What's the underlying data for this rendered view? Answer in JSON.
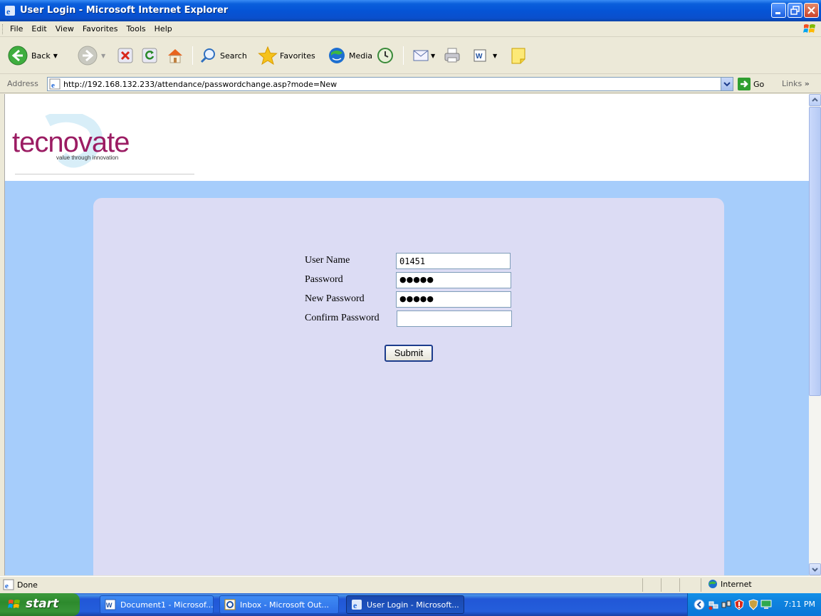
{
  "window": {
    "title": "User Login - Microsoft Internet Explorer"
  },
  "menu": {
    "items": [
      "File",
      "Edit",
      "View",
      "Favorites",
      "Tools",
      "Help"
    ]
  },
  "toolbar": {
    "back_label": "Back",
    "search_label": "Search",
    "favorites_label": "Favorites",
    "media_label": "Media"
  },
  "addressbar": {
    "label": "Address",
    "url": "http://192.168.132.233/attendance/passwordchange.asp?mode=New",
    "go_label": "Go",
    "links_label": "Links"
  },
  "page": {
    "logo_text": "tecnovate",
    "logo_tagline": "value through innovation",
    "form": {
      "username_label": "User Name",
      "username_value": "01451",
      "password_label": "Password",
      "password_value": "●●●●●",
      "new_password_label": "New Password",
      "new_password_value": "●●●●●",
      "confirm_password_label": "Confirm Password",
      "confirm_password_value": "",
      "submit_label": "Submit"
    }
  },
  "statusbar": {
    "status_text": "Done",
    "zone_text": "Internet"
  },
  "taskbar": {
    "start_label": "start",
    "tasks": [
      {
        "label": "Document1 - Microsof...",
        "icon": "word-icon"
      },
      {
        "label": "Inbox - Microsoft Out...",
        "icon": "outlook-icon"
      },
      {
        "label": "User Login - Microsoft...",
        "icon": "ie-icon"
      }
    ],
    "clock": "7:11 PM"
  },
  "colors": {
    "page_blue": "#a6cdfb",
    "panel_lavender": "#dcdcf4",
    "logo_magenta": "#9b1c63",
    "xp_blue": "#0554d6",
    "start_green": "#2d8a2d"
  }
}
